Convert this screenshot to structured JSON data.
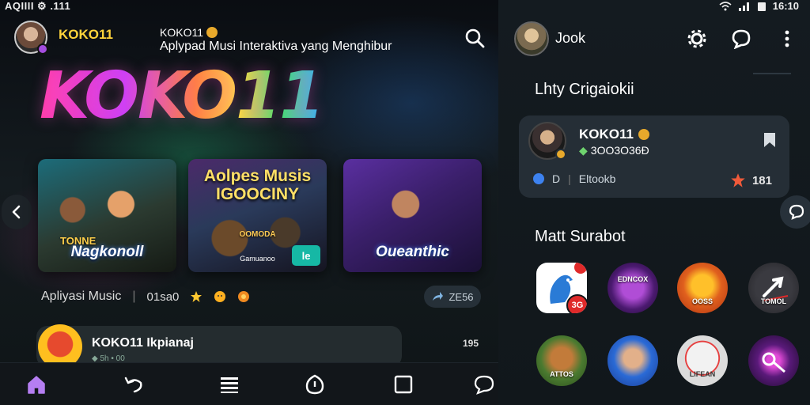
{
  "status_bar": {
    "left": "AQIIII ⚙ .111",
    "right_time": "16:10"
  },
  "left_panel": {
    "app_name": "KOKO11",
    "header_title": "KOKO11",
    "header_subtitle": "Aplypad Musi Interaktiva yang Menghibur",
    "logo_text": "KOKO11",
    "cards": [
      {
        "title": "Nagkonoll",
        "overlay": "TONNE"
      },
      {
        "title": "Aolpes Musis IGOOCINY",
        "subtitle": "OOMODA",
        "tag": "Gamuanoo",
        "pill": "le"
      },
      {
        "title": "Oueanthic"
      }
    ],
    "info": {
      "label": "Apliyasi Music",
      "count": "01sa0"
    },
    "share_pill": "ZE56",
    "list_item": {
      "title": "KOKO11 Ikpianaj",
      "meta": "◆ 5h • 00",
      "count": "195"
    },
    "icons": {
      "search": "search-icon",
      "prev": "chevron-left-icon",
      "nav": [
        "home-icon",
        "back-arrow-icon",
        "list-icon",
        "compass-icon",
        "square-icon",
        "chat-icon"
      ]
    },
    "accent": "#ffd43b"
  },
  "right_panel": {
    "profile_name": "Jook",
    "section_1": "Lhty Crigaiokii",
    "featured": {
      "name": "KOKO11",
      "code": "3OO3O36Ð",
      "foot_mid": "D",
      "foot_label": "Eltookb",
      "rating": "181"
    },
    "section_2": "Matt Surabot",
    "apps": [
      {
        "label": "",
        "badge": "3G"
      },
      {
        "label": "EDNCOX"
      },
      {
        "label": "OOSS"
      },
      {
        "label": "TOMOL"
      },
      {
        "label": "ATTOS"
      },
      {
        "label": ""
      },
      {
        "label": "LIFEAN"
      },
      {
        "label": ""
      }
    ],
    "icons": {
      "settings": "settings-icon",
      "chat": "chat-icon",
      "more": "more-vertical-icon"
    }
  }
}
